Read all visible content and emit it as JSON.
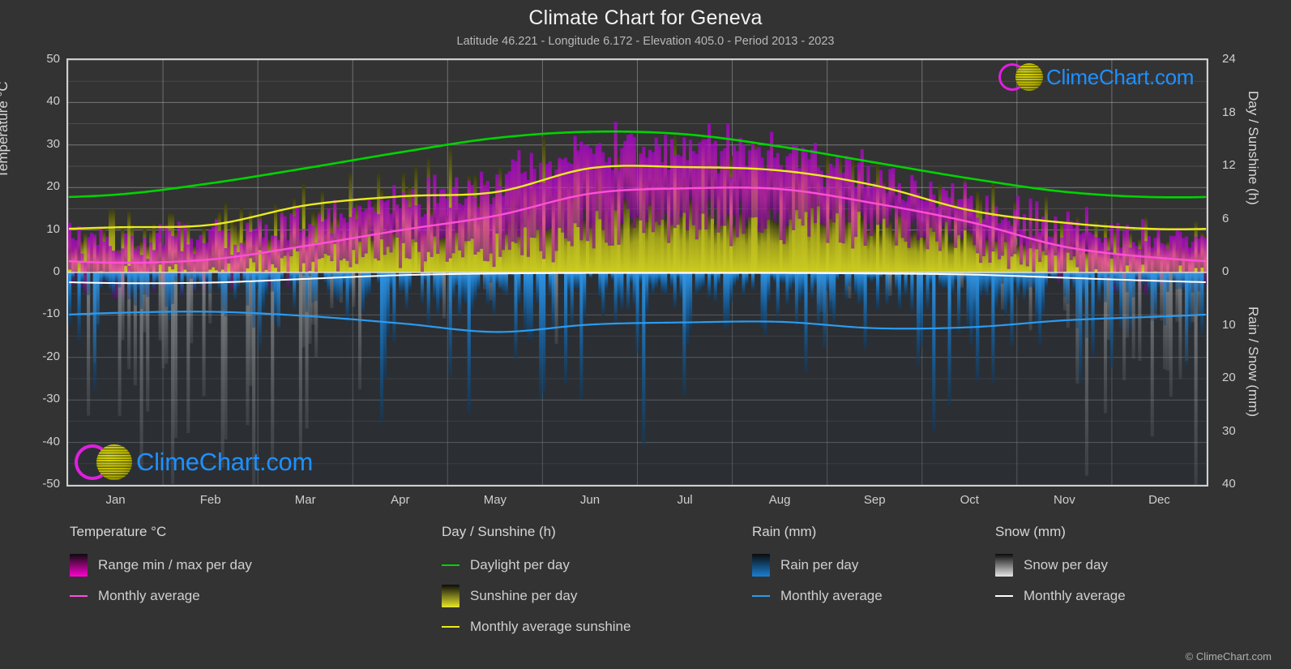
{
  "header": {
    "title": "Climate Chart for Geneva",
    "subtitle": "Latitude 46.221 - Longitude 6.172 - Elevation 405.0 - Period 2013 - 2023"
  },
  "axes": {
    "left_label": "Temperature °C",
    "right_label_top": "Day / Sunshine (h)",
    "right_label_bottom": "Rain / Snow (mm)",
    "left_ticks": [
      "50",
      "40",
      "30",
      "20",
      "10",
      "0",
      "-10",
      "-20",
      "-30",
      "-40",
      "-50"
    ],
    "right_ticks_top": [
      "24",
      "18",
      "12",
      "6",
      "0"
    ],
    "right_ticks_bottom": [
      "10",
      "20",
      "30",
      "40"
    ],
    "x_ticks": [
      "Jan",
      "Feb",
      "Mar",
      "Apr",
      "May",
      "Jun",
      "Jul",
      "Aug",
      "Sep",
      "Oct",
      "Nov",
      "Dec"
    ]
  },
  "legend": {
    "temperature": {
      "heading": "Temperature °C",
      "items": [
        {
          "label": "Range min / max per day",
          "marker": "gradient-swatch",
          "color": "#ff00d0"
        },
        {
          "label": "Monthly average",
          "marker": "line",
          "color": "#ff4fd8"
        }
      ]
    },
    "sunshine": {
      "heading": "Day / Sunshine (h)",
      "items": [
        {
          "label": "Daylight per day",
          "marker": "line",
          "color": "#00d400"
        },
        {
          "label": "Sunshine per day",
          "marker": "gradient-swatch",
          "color": "#e8e82a"
        },
        {
          "label": "Monthly average sunshine",
          "marker": "line",
          "color": "#eaea20"
        }
      ]
    },
    "rain": {
      "heading": "Rain (mm)",
      "items": [
        {
          "label": "Rain per day",
          "marker": "gradient-swatch",
          "color": "#1a7fd4"
        },
        {
          "label": "Monthly average",
          "marker": "line",
          "color": "#2b9bf0"
        }
      ]
    },
    "snow": {
      "heading": "Snow (mm)",
      "items": [
        {
          "label": "Snow per day",
          "marker": "gradient-swatch",
          "color": "#e6e6e6"
        },
        {
          "label": "Monthly average",
          "marker": "line",
          "color": "#ffffff"
        }
      ]
    }
  },
  "watermark": {
    "text": "ClimeChart.com",
    "ring_color": "#e01fe0",
    "globe_color": "#d9d700",
    "text_color": "#1e90ff"
  },
  "footer": {
    "copyright": "© ClimeChart.com"
  },
  "chart_data": {
    "type": "line",
    "title": "Climate Chart for Geneva",
    "subtitle": "Latitude 46.221 - Longitude 6.172 - Elevation 405.0 - Period 2013 - 2023",
    "xlabel": "",
    "ylabel": "Temperature °C",
    "ylim": [
      -50,
      50
    ],
    "y2_top_label": "Day / Sunshine (h)",
    "y2_top_lim": [
      0,
      24
    ],
    "y2_bottom_label": "Rain / Snow (mm)",
    "y2_bottom_lim": [
      0,
      40
    ],
    "grid": true,
    "legend_position": "below",
    "categories": [
      "Jan",
      "Feb",
      "Mar",
      "Apr",
      "May",
      "Jun",
      "Jul",
      "Aug",
      "Sep",
      "Oct",
      "Nov",
      "Dec"
    ],
    "series": [
      {
        "name": "Daylight per day",
        "units": "h",
        "color": "#00d400",
        "axis": "right-top",
        "values": [
          8.8,
          10.1,
          11.8,
          13.6,
          15.2,
          15.9,
          15.6,
          14.2,
          12.4,
          10.6,
          9.1,
          8.5
        ]
      },
      {
        "name": "Monthly average sunshine",
        "units": "h",
        "color": "#eaea20",
        "axis": "right-top",
        "values": [
          5.1,
          5.4,
          7.6,
          8.6,
          9.1,
          11.8,
          11.9,
          11.5,
          9.8,
          7.0,
          5.6,
          4.9
        ]
      },
      {
        "name": "Monthly average temperature",
        "units": "°C",
        "color": "#ff4fd8",
        "axis": "left",
        "values": [
          2.3,
          3.1,
          6.3,
          10.0,
          13.4,
          18.6,
          19.8,
          19.6,
          16.2,
          11.8,
          6.0,
          3.4
        ]
      },
      {
        "name": "Rain monthly average",
        "units": "mm",
        "color": "#2b9bf0",
        "axis": "right-bottom",
        "values": [
          7.6,
          7.4,
          8.2,
          9.6,
          11.2,
          9.8,
          9.4,
          9.3,
          10.5,
          10.3,
          9.0,
          8.3
        ]
      },
      {
        "name": "Snow monthly average",
        "units": "mm",
        "color": "#ffffff",
        "axis": "right-bottom",
        "values": [
          2.0,
          1.9,
          1.2,
          0.5,
          0.2,
          0.1,
          0.1,
          0.1,
          0.2,
          0.4,
          1.0,
          1.6
        ]
      }
    ],
    "daily_bands": [
      {
        "name": "Temperature range min / max per day",
        "color": "#ff00d0",
        "axis": "left"
      },
      {
        "name": "Sunshine per day",
        "color": "#e8e82a",
        "axis": "right-top"
      },
      {
        "name": "Rain per day",
        "color": "#1a7fd4",
        "axis": "right-bottom"
      },
      {
        "name": "Snow per day",
        "color": "#e6e6e6",
        "axis": "right-bottom"
      }
    ]
  }
}
